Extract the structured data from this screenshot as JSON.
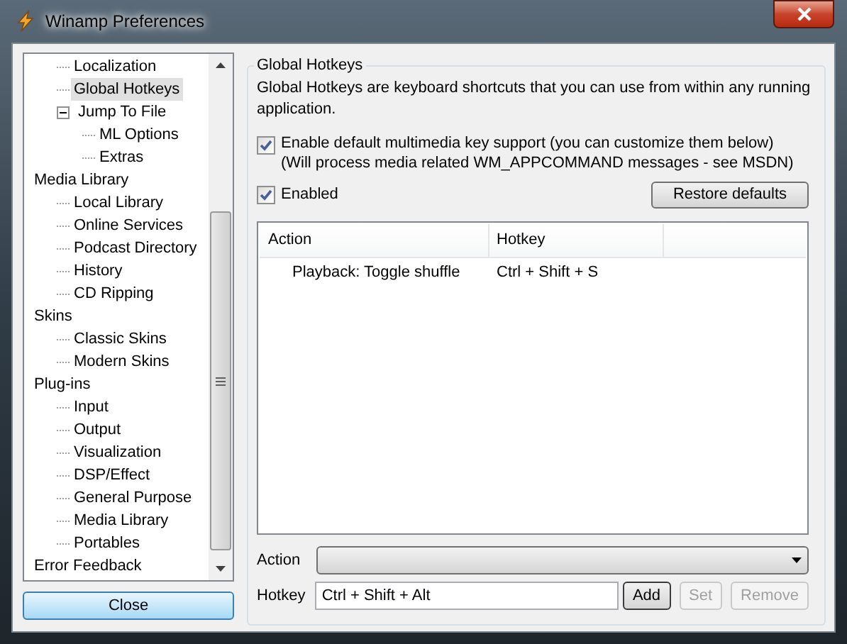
{
  "window": {
    "title": "Winamp Preferences"
  },
  "tree": {
    "continued": [
      {
        "label": "Localization",
        "selected": false
      },
      {
        "label": "Global Hotkeys",
        "selected": true
      },
      {
        "label": "Jump To File",
        "selected": false,
        "expanded": true,
        "children": [
          {
            "label": "ML Options",
            "selected": false
          },
          {
            "label": "Extras",
            "selected": false
          }
        ]
      }
    ],
    "items": [
      {
        "label": "Media Library",
        "selected": false,
        "children": [
          {
            "label": "Local Library",
            "selected": false
          },
          {
            "label": "Online Services",
            "selected": false
          },
          {
            "label": "Podcast Directory",
            "selected": false
          },
          {
            "label": "History",
            "selected": false
          },
          {
            "label": "CD Ripping",
            "selected": false
          }
        ]
      },
      {
        "label": "Skins",
        "selected": false,
        "children": [
          {
            "label": "Classic Skins",
            "selected": false
          },
          {
            "label": "Modern Skins",
            "selected": false
          }
        ]
      },
      {
        "label": "Plug-ins",
        "selected": false,
        "children": [
          {
            "label": "Input",
            "selected": false
          },
          {
            "label": "Output",
            "selected": false
          },
          {
            "label": "Visualization",
            "selected": false
          },
          {
            "label": "DSP/Effect",
            "selected": false
          },
          {
            "label": "General Purpose",
            "selected": false
          },
          {
            "label": "Media Library",
            "selected": false
          },
          {
            "label": "Portables",
            "selected": false
          }
        ]
      },
      {
        "label": "Error Feedback",
        "selected": false
      }
    ]
  },
  "close_button": "Close",
  "group": {
    "title": "Global Hotkeys",
    "description": "Global Hotkeys are keyboard shortcuts that you can use from within any running application.",
    "multimedia": {
      "label": "Enable default multimedia key support (you can customize them below)",
      "note": "(Will process media related WM_APPCOMMAND messages - see MSDN)",
      "checked": true
    },
    "enabled": {
      "label": "Enabled",
      "checked": true
    },
    "restore_button": "Restore defaults",
    "table": {
      "columns": [
        "Action",
        "Hotkey"
      ],
      "rows": [
        [
          "Playback: Toggle shuffle",
          "Ctrl + Shift + S"
        ]
      ]
    },
    "action": {
      "label": "Action"
    },
    "hotkey": {
      "label": "Hotkey",
      "value": "Ctrl + Shift + Alt"
    },
    "buttons": [
      {
        "label": "Add",
        "disabled": false
      },
      {
        "label": "Set",
        "disabled": true
      },
      {
        "label": "Remove",
        "disabled": true
      }
    ]
  }
}
